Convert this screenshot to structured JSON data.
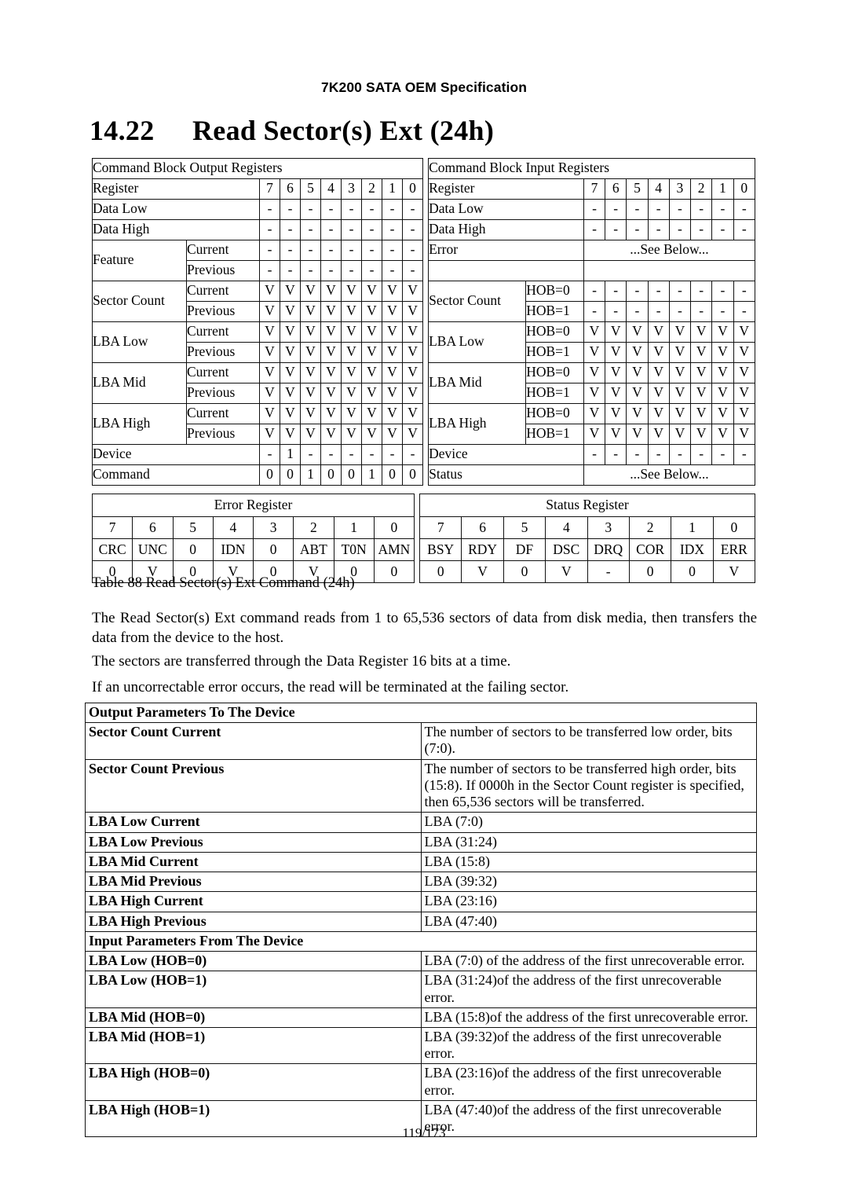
{
  "header": {
    "running_title": "7K200 SATA OEM Specification"
  },
  "section": {
    "number": "14.22",
    "title": "Read Sector(s) Ext (24h)"
  },
  "output_table": {
    "caption": "Command Block Output Registers",
    "register_label": "Register",
    "bit_headers": [
      "7",
      "6",
      "5",
      "4",
      "3",
      "2",
      "1",
      "0"
    ],
    "rows": [
      {
        "name": "Data Low",
        "sub": "",
        "bits": [
          "-",
          "-",
          "-",
          "-",
          "-",
          "-",
          "-",
          "-"
        ]
      },
      {
        "name": "Data High",
        "sub": "",
        "bits": [
          "-",
          "-",
          "-",
          "-",
          "-",
          "-",
          "-",
          "-"
        ]
      },
      {
        "name": "Feature",
        "sub": "Current",
        "bits": [
          "-",
          "-",
          "-",
          "-",
          "-",
          "-",
          "-",
          "-"
        ]
      },
      {
        "name": "",
        "sub": "Previous",
        "bits": [
          "-",
          "-",
          "-",
          "-",
          "-",
          "-",
          "-",
          "-"
        ]
      },
      {
        "name": "Sector Count",
        "sub": "Current",
        "bits": [
          "V",
          "V",
          "V",
          "V",
          "V",
          "V",
          "V",
          "V"
        ]
      },
      {
        "name": "",
        "sub": "Previous",
        "bits": [
          "V",
          "V",
          "V",
          "V",
          "V",
          "V",
          "V",
          "V"
        ]
      },
      {
        "name": "LBA Low",
        "sub": "Current",
        "bits": [
          "V",
          "V",
          "V",
          "V",
          "V",
          "V",
          "V",
          "V"
        ]
      },
      {
        "name": "",
        "sub": "Previous",
        "bits": [
          "V",
          "V",
          "V",
          "V",
          "V",
          "V",
          "V",
          "V"
        ]
      },
      {
        "name": "LBA Mid",
        "sub": "Current",
        "bits": [
          "V",
          "V",
          "V",
          "V",
          "V",
          "V",
          "V",
          "V"
        ]
      },
      {
        "name": "",
        "sub": "Previous",
        "bits": [
          "V",
          "V",
          "V",
          "V",
          "V",
          "V",
          "V",
          "V"
        ]
      },
      {
        "name": "LBA High",
        "sub": "Current",
        "bits": [
          "V",
          "V",
          "V",
          "V",
          "V",
          "V",
          "V",
          "V"
        ]
      },
      {
        "name": "",
        "sub": "Previous",
        "bits": [
          "V",
          "V",
          "V",
          "V",
          "V",
          "V",
          "V",
          "V"
        ]
      },
      {
        "name": "Device",
        "sub": "",
        "bits": [
          "-",
          "1",
          "-",
          "-",
          "-",
          "-",
          "-",
          "-"
        ]
      },
      {
        "name": "Command",
        "sub": "",
        "bits": [
          "0",
          "0",
          "1",
          "0",
          "0",
          "1",
          "0",
          "0"
        ]
      }
    ]
  },
  "input_table": {
    "caption": "Command Block Input Registers",
    "register_label": "Register",
    "bit_headers": [
      "7",
      "6",
      "5",
      "4",
      "3",
      "2",
      "1",
      "0"
    ],
    "see_below": "...See Below...",
    "rows": [
      {
        "name": "Data Low",
        "sub": "",
        "bits": [
          "-",
          "-",
          "-",
          "-",
          "-",
          "-",
          "-",
          "-"
        ]
      },
      {
        "name": "Data High",
        "sub": "",
        "bits": [
          "-",
          "-",
          "-",
          "-",
          "-",
          "-",
          "-",
          "-"
        ]
      },
      {
        "name": "Error",
        "sub": "",
        "merged": "...See Below..."
      },
      {
        "name": "Sector Count",
        "sub": "HOB=0",
        "bits": [
          "-",
          "-",
          "-",
          "-",
          "-",
          "-",
          "-",
          "-"
        ]
      },
      {
        "name": "",
        "sub": "HOB=1",
        "bits": [
          "-",
          "-",
          "-",
          "-",
          "-",
          "-",
          "-",
          "-"
        ]
      },
      {
        "name": "LBA Low",
        "sub": "HOB=0",
        "bits": [
          "V",
          "V",
          "V",
          "V",
          "V",
          "V",
          "V",
          "V"
        ]
      },
      {
        "name": "",
        "sub": "HOB=1",
        "bits": [
          "V",
          "V",
          "V",
          "V",
          "V",
          "V",
          "V",
          "V"
        ]
      },
      {
        "name": "LBA Mid",
        "sub": "HOB=0",
        "bits": [
          "V",
          "V",
          "V",
          "V",
          "V",
          "V",
          "V",
          "V"
        ]
      },
      {
        "name": "",
        "sub": "HOB=1",
        "bits": [
          "V",
          "V",
          "V",
          "V",
          "V",
          "V",
          "V",
          "V"
        ]
      },
      {
        "name": "LBA High",
        "sub": "HOB=0",
        "bits": [
          "V",
          "V",
          "V",
          "V",
          "V",
          "V",
          "V",
          "V"
        ]
      },
      {
        "name": "",
        "sub": "HOB=1",
        "bits": [
          "V",
          "V",
          "V",
          "V",
          "V",
          "V",
          "V",
          "V"
        ]
      },
      {
        "name": "Device",
        "sub": "",
        "bits": [
          "-",
          "-",
          "-",
          "-",
          "-",
          "-",
          "-",
          "-"
        ]
      },
      {
        "name": "Status",
        "sub": "",
        "merged": "...See Below..."
      }
    ]
  },
  "error_register": {
    "title": "Error Register",
    "bit_numbers": [
      "7",
      "6",
      "5",
      "4",
      "3",
      "2",
      "1",
      "0"
    ],
    "bit_names": [
      "CRC",
      "UNC",
      "0",
      "IDN",
      "0",
      "ABT",
      "T0N",
      "AMN"
    ],
    "bit_values": [
      "0",
      "V",
      "0",
      "V",
      "0",
      "V",
      "0",
      "0"
    ]
  },
  "status_register": {
    "title": "Status Register",
    "bit_numbers": [
      "7",
      "6",
      "5",
      "4",
      "3",
      "2",
      "1",
      "0"
    ],
    "bit_names": [
      "BSY",
      "RDY",
      "DF",
      "DSC",
      "DRQ",
      "COR",
      "IDX",
      "ERR"
    ],
    "bit_values": [
      "0",
      "V",
      "0",
      "V",
      "-",
      "0",
      "0",
      "V"
    ]
  },
  "table_caption": "Table 88 Read Sector(s) Ext Command (24h)",
  "paragraphs": {
    "p1": "The Read Sector(s) Ext command reads from 1 to 65,536 sectors of data from disk media, then transfers the data from the device to the host.",
    "p2": "The sectors are transferred through the Data Register 16 bits at a time.",
    "p3": "If an uncorrectable error occurs, the read will be terminated at the failing sector."
  },
  "parameters": {
    "output_heading": "Output Parameters To The Device",
    "output_rows": [
      {
        "key": "Sector Count Current",
        "value": "The number of sectors to be transferred low order, bits (7:0)."
      },
      {
        "key": "Sector Count Previous",
        "value": "The number of sectors to be transferred high order, bits (15:8). If 0000h in the Sector Count register is specified, then 65,536 sectors will be transferred."
      },
      {
        "key": "LBA Low Current",
        "value": "LBA (7:0)"
      },
      {
        "key": "LBA Low Previous",
        "value": "LBA (31:24)"
      },
      {
        "key": "LBA Mid Current",
        "value": "LBA (15:8)"
      },
      {
        "key": "LBA Mid Previous",
        "value": "LBA (39:32)"
      },
      {
        "key": "LBA High Current",
        "value": "LBA (23:16)"
      },
      {
        "key": "LBA High Previous",
        "value": "LBA (47:40)"
      }
    ],
    "input_heading": "Input Parameters From The Device",
    "input_rows": [
      {
        "key": "LBA Low (HOB=0)",
        "value": "LBA (7:0) of the address of the first unrecoverable error."
      },
      {
        "key": "LBA Low (HOB=1)",
        "value": "LBA (31:24)of the address of the first unrecoverable error."
      },
      {
        "key": "LBA Mid (HOB=0)",
        "value": "LBA (15:8)of the address of the first unrecoverable error."
      },
      {
        "key": "LBA Mid (HOB=1)",
        "value": "LBA (39:32)of the address of the first unrecoverable error."
      },
      {
        "key": "LBA High (HOB=0)",
        "value": "LBA (23:16)of the address of the first unrecoverable error."
      },
      {
        "key": "LBA High (HOB=1)",
        "value": "LBA (47:40)of the address of the first unrecoverable error."
      }
    ]
  },
  "footer": {
    "page": "119/173"
  }
}
